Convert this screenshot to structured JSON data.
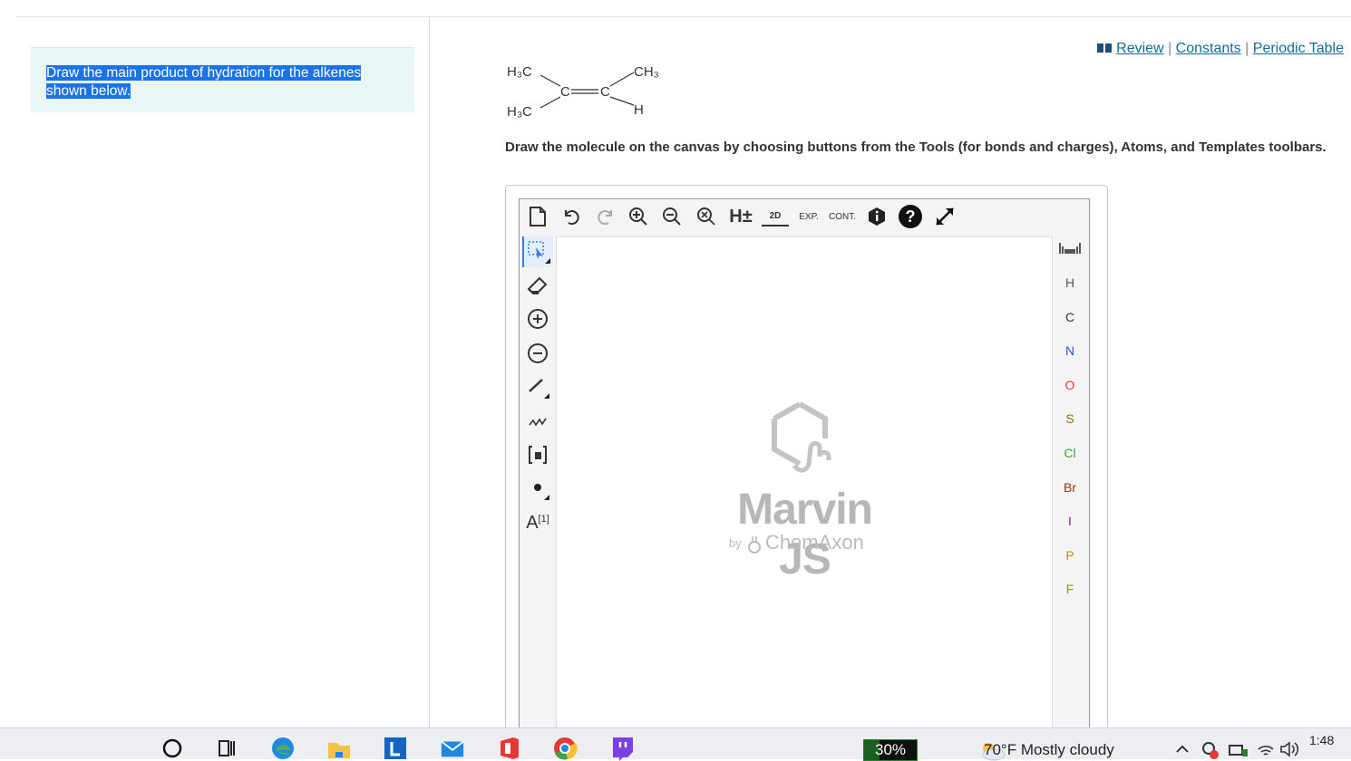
{
  "prompt": {
    "text": "Draw the main product of hydration for the alkenes shown below."
  },
  "links": {
    "review": "Review",
    "constants": "Constants",
    "periodic_table": "Periodic Table",
    "separator": "|"
  },
  "molecule": {
    "atoms": {
      "top_left": "H₃C",
      "top_right": "CH₃",
      "bottom_left": "H₃C",
      "bottom_right": "H",
      "c1": "C",
      "c2": "C"
    }
  },
  "instruction": "Draw the molecule on the canvas by choosing buttons from the Tools (for bonds and charges), Atoms, and Templates toolbars.",
  "editor": {
    "top_toolbar": [
      {
        "name": "new-document-icon"
      },
      {
        "name": "undo-icon"
      },
      {
        "name": "redo-icon"
      },
      {
        "name": "zoom-in-icon"
      },
      {
        "name": "zoom-out-icon"
      },
      {
        "name": "zoom-fit-icon"
      },
      {
        "name": "hydrogen-toggle-icon",
        "label": "H±"
      },
      {
        "name": "clean-2d-icon",
        "label": "2D"
      },
      {
        "name": "expand-icon",
        "label": "EXP."
      },
      {
        "name": "contract-icon",
        "label": "CONT."
      },
      {
        "name": "info-icon"
      },
      {
        "name": "help-icon"
      },
      {
        "name": "fullscreen-icon"
      }
    ],
    "left_toolbar": [
      {
        "name": "select-icon"
      },
      {
        "name": "eraser-icon"
      },
      {
        "name": "positive-charge-icon"
      },
      {
        "name": "negative-charge-icon"
      },
      {
        "name": "single-bond-icon"
      },
      {
        "name": "chain-icon"
      },
      {
        "name": "bracket-icon"
      },
      {
        "name": "radical-icon"
      },
      {
        "name": "atom-map-icon",
        "label": "A",
        "sup": "[1]"
      }
    ],
    "atoms": [
      {
        "symbol": "H",
        "color": "#555555"
      },
      {
        "symbol": "C",
        "color": "#333333"
      },
      {
        "symbol": "N",
        "color": "#3b4fd8"
      },
      {
        "symbol": "O",
        "color": "#e53935"
      },
      {
        "symbol": "S",
        "color": "#8d7a12"
      },
      {
        "symbol": "Cl",
        "color": "#3aa53a"
      },
      {
        "symbol": "Br",
        "color": "#8b3a1a"
      },
      {
        "symbol": "I",
        "color": "#8e24aa"
      },
      {
        "symbol": "P",
        "color": "#c8861a"
      },
      {
        "symbol": "F",
        "color": "#8d9a12"
      }
    ],
    "watermark": {
      "title": "Marvin JS",
      "by": "by",
      "company": "ChemAxon"
    }
  },
  "taskbar": {
    "battery": "30%",
    "battery_level": 0.3,
    "weather": "70°F  Mostly cloudy",
    "clock_time": "1:48"
  }
}
